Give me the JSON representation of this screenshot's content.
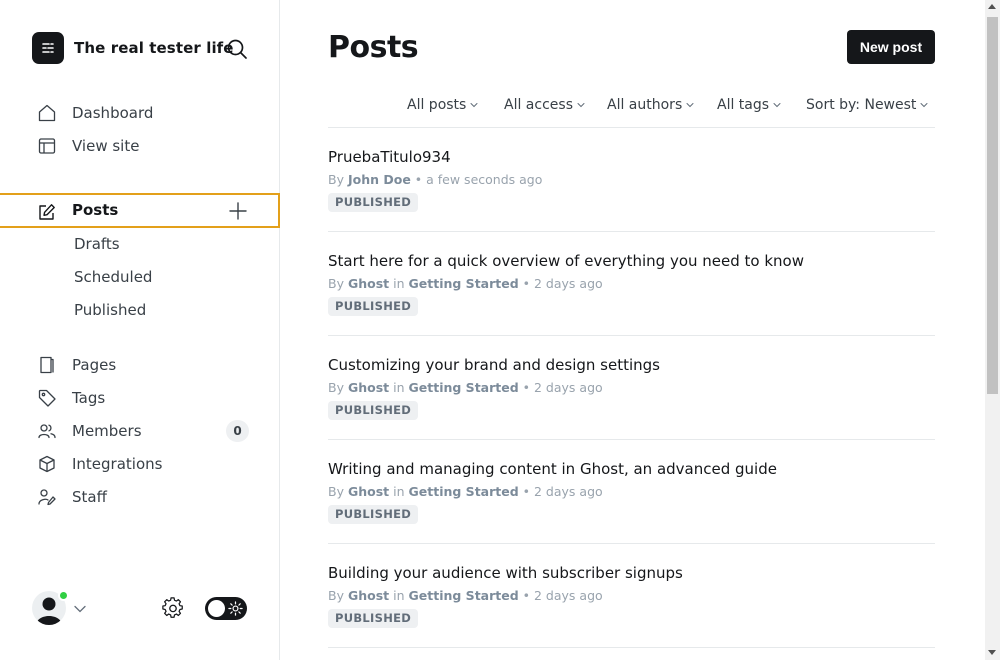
{
  "sidebar": {
    "site_title": "The real tester life",
    "nav_main": [
      {
        "label": "Dashboard",
        "icon": "house-icon"
      },
      {
        "label": "View site",
        "icon": "browser-layout-icon"
      }
    ],
    "posts": {
      "label": "Posts",
      "icon": "edit-pencil-icon",
      "add_icon": "plus-icon",
      "sub": [
        "Drafts",
        "Scheduled",
        "Published"
      ]
    },
    "nav_secondary": [
      {
        "label": "Pages",
        "icon": "page-icon"
      },
      {
        "label": "Tags",
        "icon": "tag-icon"
      },
      {
        "label": "Members",
        "icon": "members-icon",
        "count": "0"
      },
      {
        "label": "Integrations",
        "icon": "cube-icon"
      },
      {
        "label": "Staff",
        "icon": "staff-icon"
      }
    ],
    "footer": {
      "avatar_icon": "user-avatar-icon",
      "online_color": "#30cf43",
      "settings_icon": "gear-icon",
      "theme_toggle_icon": "sun-icon"
    }
  },
  "main": {
    "title": "Posts",
    "new_post_label": "New post",
    "filters": [
      "All posts",
      "All access",
      "All authors",
      "All tags",
      "Sort by: Newest"
    ],
    "posts": [
      {
        "title": "PruebaTitulo934",
        "by": "By",
        "author": "John Doe",
        "in": "",
        "tag": "",
        "time": "a few seconds ago",
        "status": "PUBLISHED"
      },
      {
        "title": "Start here for a quick overview of everything you need to know",
        "by": "By",
        "author": "Ghost",
        "in": "in",
        "tag": "Getting Started",
        "time": "2 days ago",
        "status": "PUBLISHED"
      },
      {
        "title": "Customizing your brand and design settings",
        "by": "By",
        "author": "Ghost",
        "in": "in",
        "tag": "Getting Started",
        "time": "2 days ago",
        "status": "PUBLISHED"
      },
      {
        "title": "Writing and managing content in Ghost, an advanced guide",
        "by": "By",
        "author": "Ghost",
        "in": "in",
        "tag": "Getting Started",
        "time": "2 days ago",
        "status": "PUBLISHED"
      },
      {
        "title": "Building your audience with subscriber signups",
        "by": "By",
        "author": "Ghost",
        "in": "in",
        "tag": "Getting Started",
        "time": "2 days ago",
        "status": "PUBLISHED"
      }
    ]
  },
  "colors": {
    "accent_outline": "#e3a01a",
    "button_bg": "#15171a",
    "meta_text": "#99a3ad"
  }
}
